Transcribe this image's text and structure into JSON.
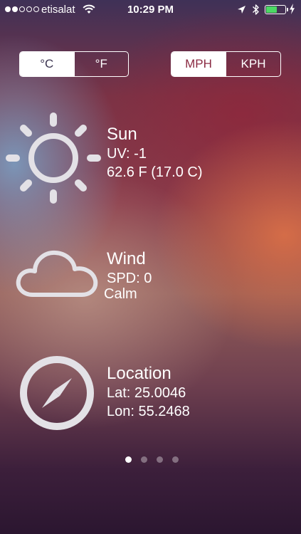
{
  "status_bar": {
    "carrier": "etisalat",
    "time": "10:29 PM",
    "signal_bars_filled": 2,
    "signal_bars_total": 5,
    "battery_fraction": 0.6,
    "battery_color": "#4cd964"
  },
  "units": {
    "temperature": {
      "options": [
        "°C",
        "°F"
      ],
      "selected": "°C"
    },
    "speed": {
      "options": [
        "MPH",
        "KPH"
      ],
      "selected": "MPH"
    }
  },
  "sun": {
    "title": "Sun",
    "uv": "UV: -1",
    "temperature": "62.6 F (17.0 C)",
    "icon": "sun-icon"
  },
  "wind": {
    "title": "Wind",
    "speed": "SPD: 0",
    "description": "Calm",
    "icon": "cloud-icon"
  },
  "location": {
    "title": "Location",
    "lat": "Lat: 25.0046",
    "lon": "Lon: 55.2468",
    "icon": "compass-icon"
  },
  "pager": {
    "total": 4,
    "active": 1
  }
}
